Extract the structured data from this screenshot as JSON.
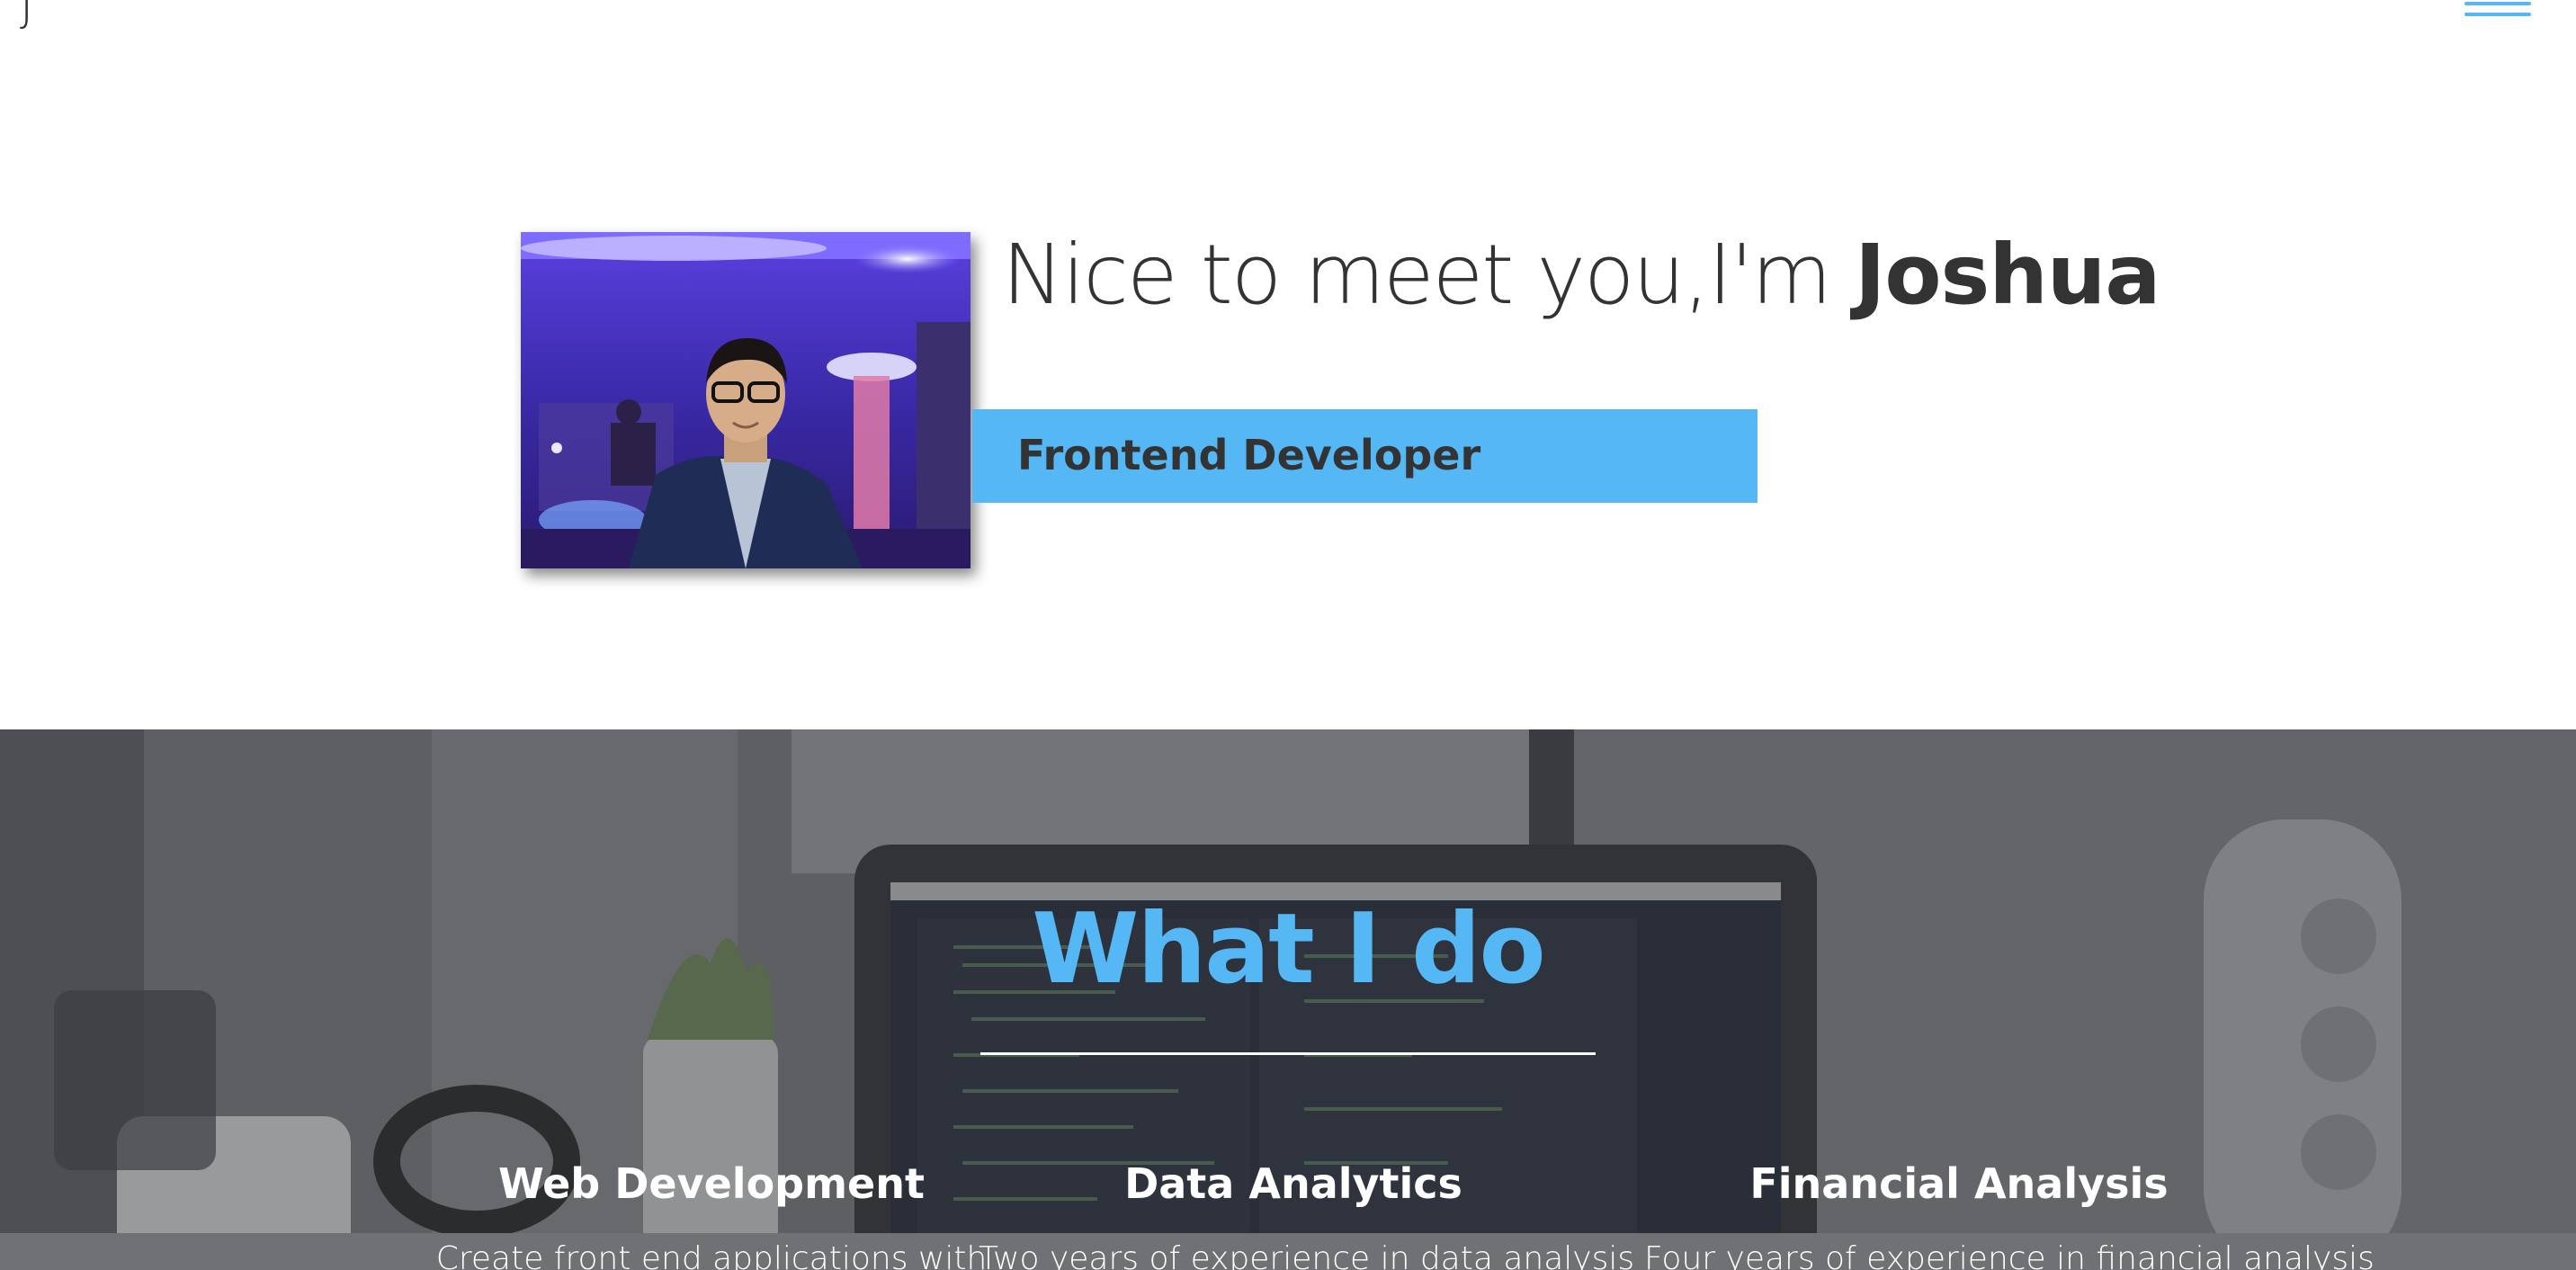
{
  "nav": {
    "logo_letter": "J"
  },
  "hero": {
    "greeting_prefix": "Nice to meet you,I'm ",
    "name": "Joshua",
    "role": "Frontend Developer"
  },
  "services": {
    "title": "What I do",
    "items": [
      {
        "title": "Web Development",
        "description": "Create front end applications with"
      },
      {
        "title": "Data Analytics",
        "description": "Two years of experience in data analysis"
      },
      {
        "title": "Financial Analysis",
        "description": "Four years of experience in financial analysis"
      }
    ]
  },
  "colors": {
    "accent": "#55b8f4",
    "text_dark": "#333333",
    "section_bg": "#6d6e71"
  }
}
